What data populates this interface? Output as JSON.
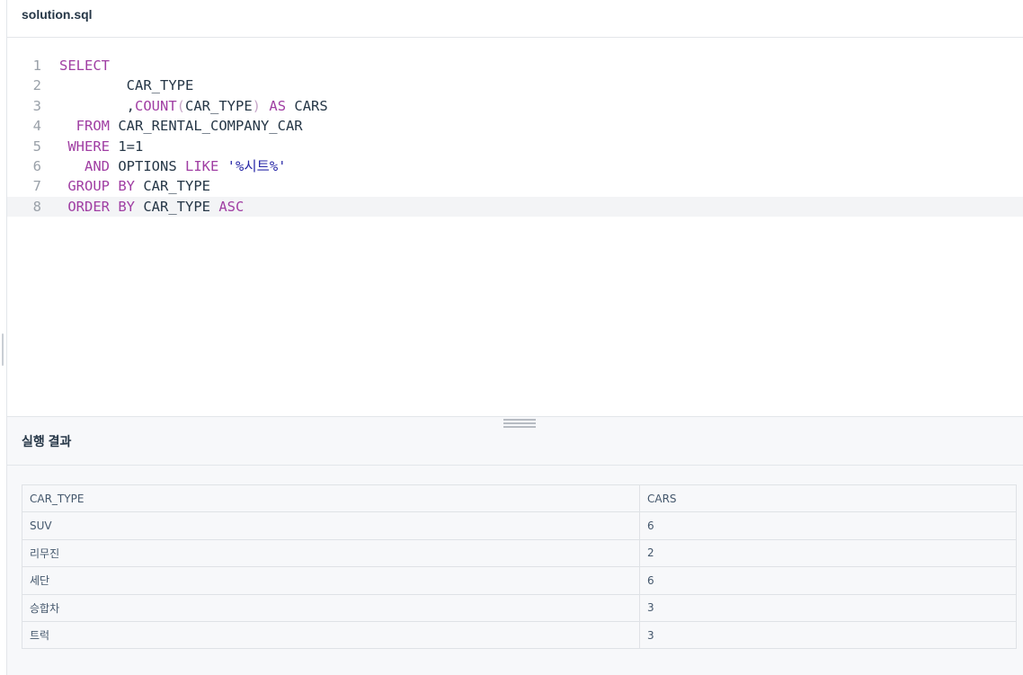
{
  "editor": {
    "filename": "solution.sql",
    "lines": [
      {
        "num": "1",
        "tokens": [
          {
            "t": "SELECT",
            "c": "kw"
          }
        ]
      },
      {
        "num": "2",
        "tokens": [
          {
            "t": "        CAR_TYPE",
            "c": ""
          }
        ]
      },
      {
        "num": "3",
        "tokens": [
          {
            "t": "        ,",
            "c": ""
          },
          {
            "t": "COUNT",
            "c": "kw"
          },
          {
            "t": "(",
            "c": "paren"
          },
          {
            "t": "CAR_TYPE",
            "c": ""
          },
          {
            "t": ")",
            "c": "paren"
          },
          {
            "t": " ",
            "c": ""
          },
          {
            "t": "AS",
            "c": "kw"
          },
          {
            "t": " CARS",
            "c": ""
          }
        ]
      },
      {
        "num": "4",
        "tokens": [
          {
            "t": "  ",
            "c": ""
          },
          {
            "t": "FROM",
            "c": "kw"
          },
          {
            "t": " CAR_RENTAL_COMPANY_CAR",
            "c": ""
          }
        ]
      },
      {
        "num": "5",
        "tokens": [
          {
            "t": " ",
            "c": ""
          },
          {
            "t": "WHERE",
            "c": "kw"
          },
          {
            "t": " 1=1",
            "c": ""
          }
        ]
      },
      {
        "num": "6",
        "tokens": [
          {
            "t": "   ",
            "c": ""
          },
          {
            "t": "AND",
            "c": "kw"
          },
          {
            "t": " OPTIONS ",
            "c": ""
          },
          {
            "t": "LIKE",
            "c": "kw"
          },
          {
            "t": " ",
            "c": ""
          },
          {
            "t": "'%시트%'",
            "c": "str"
          }
        ]
      },
      {
        "num": "7",
        "tokens": [
          {
            "t": " ",
            "c": ""
          },
          {
            "t": "GROUP BY",
            "c": "kw"
          },
          {
            "t": " CAR_TYPE",
            "c": ""
          }
        ]
      },
      {
        "num": "8",
        "active": true,
        "tokens": [
          {
            "t": " ",
            "c": ""
          },
          {
            "t": "ORDER BY",
            "c": "kw"
          },
          {
            "t": " CAR_TYPE ",
            "c": ""
          },
          {
            "t": "ASC",
            "c": "kw"
          }
        ]
      }
    ]
  },
  "results": {
    "title": "실행 결과",
    "columns": [
      "CAR_TYPE",
      "CARS"
    ],
    "rows": [
      [
        "SUV",
        "6"
      ],
      [
        "리무진",
        "2"
      ],
      [
        "세단",
        "6"
      ],
      [
        "승합차",
        "3"
      ],
      [
        "트럭",
        "3"
      ]
    ]
  },
  "colors": {
    "keyword": "#a03ea3",
    "string": "#2a2aa8",
    "text": "#263747",
    "line_number": "#9aa1a9"
  }
}
